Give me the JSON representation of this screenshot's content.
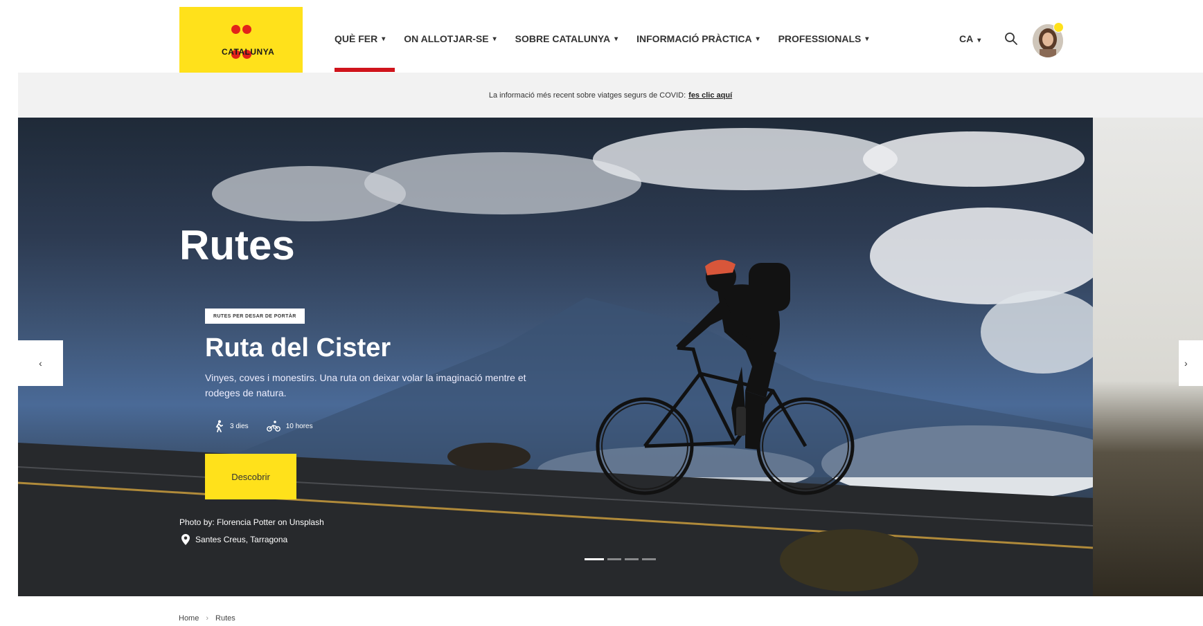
{
  "header": {
    "logo_text": "CATALUNYA",
    "nav": [
      {
        "label": "QUÈ FER"
      },
      {
        "label": "ON ALLOTJAR-SE"
      },
      {
        "label": "SOBRE CATALUNYA"
      },
      {
        "label": "INFORMACIÓ PRÀCTICA"
      },
      {
        "label": "PROFESSIONALS"
      }
    ],
    "language": "CA",
    "icons": {
      "search": "search-icon",
      "avatar": "user-avatar",
      "chevron": "chevron-down-icon"
    }
  },
  "banner": {
    "text": "La informació més recent sobre viatges segurs de COVID:",
    "link": "fes clic aquí"
  },
  "hero": {
    "page_title": "Rutes",
    "tag": "RUTES PER DESAR DE PORTÀR",
    "route_title": "Ruta del Cister",
    "description": "Vinyes, coves i monestirs. Una ruta on deixar volar la imaginació mentre et rodeges de natura.",
    "meta": [
      {
        "icon": "hiking-icon",
        "text": "3 dies"
      },
      {
        "icon": "cycling-icon",
        "text": "10 hores"
      }
    ],
    "cta_label": "Descobrir",
    "credit": "Photo by: Florencia Potter on Unsplash",
    "location": "Santes Creus, Tarragona",
    "slide_count": 4,
    "active_slide": 1,
    "prev_label": "‹",
    "next_label": "›"
  },
  "breadcrumb": {
    "home": "Home",
    "separator": "›",
    "current": "Rutes"
  },
  "colors": {
    "brand_yellow": "#ffe11b",
    "brand_red": "#e2231a",
    "active_underline": "#d0141c"
  }
}
